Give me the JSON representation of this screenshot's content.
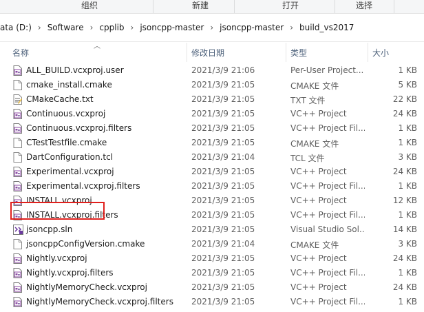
{
  "ribbon": {
    "organize": "组织",
    "new": "新建",
    "open": "打开",
    "select": "选择"
  },
  "breadcrumb": [
    "ata (D:)",
    "Software",
    "cpplib",
    "jsoncpp-master",
    "jsoncpp-master",
    "build_vs2017"
  ],
  "columns": {
    "name": "名称",
    "date": "修改日期",
    "type": "类型",
    "size": "大小"
  },
  "files": [
    {
      "name": "ALL_BUILD.vcxproj.user",
      "date": "2021/3/9 21:06",
      "type": "Per-User Project...",
      "size": "1 KB",
      "icon": "user-project-icon"
    },
    {
      "name": "cmake_install.cmake",
      "date": "2021/3/9 21:05",
      "type": "CMAKE 文件",
      "size": "5 KB",
      "icon": "file-icon"
    },
    {
      "name": "CMakeCache.txt",
      "date": "2021/3/9 21:05",
      "type": "TXT 文件",
      "size": "22 KB",
      "icon": "text-file-icon"
    },
    {
      "name": "Continuous.vcxproj",
      "date": "2021/3/9 21:05",
      "type": "VC++ Project",
      "size": "24 KB",
      "icon": "vcxproj-icon"
    },
    {
      "name": "Continuous.vcxproj.filters",
      "date": "2021/3/9 21:05",
      "type": "VC++ Project Fil...",
      "size": "1 KB",
      "icon": "vcxproj-icon"
    },
    {
      "name": "CTestTestfile.cmake",
      "date": "2021/3/9 21:05",
      "type": "CMAKE 文件",
      "size": "1 KB",
      "icon": "file-icon"
    },
    {
      "name": "DartConfiguration.tcl",
      "date": "2021/3/9 21:04",
      "type": "TCL 文件",
      "size": "3 KB",
      "icon": "file-icon"
    },
    {
      "name": "Experimental.vcxproj",
      "date": "2021/3/9 21:05",
      "type": "VC++ Project",
      "size": "24 KB",
      "icon": "vcxproj-icon"
    },
    {
      "name": "Experimental.vcxproj.filters",
      "date": "2021/3/9 21:05",
      "type": "VC++ Project Fil...",
      "size": "1 KB",
      "icon": "vcxproj-icon"
    },
    {
      "name": "INSTALL.vcxproj",
      "date": "2021/3/9 21:05",
      "type": "VC++ Project",
      "size": "12 KB",
      "icon": "vcxproj-icon"
    },
    {
      "name": "INSTALL.vcxproj.filters",
      "date": "2021/3/9 21:05",
      "type": "VC++ Project Fil...",
      "size": "1 KB",
      "icon": "vcxproj-icon"
    },
    {
      "name": "jsoncpp.sln",
      "date": "2021/3/9 21:05",
      "type": "Visual Studio Sol...",
      "size": "14 KB",
      "icon": "solution-icon"
    },
    {
      "name": "jsoncppConfigVersion.cmake",
      "date": "2021/3/9 21:04",
      "type": "CMAKE 文件",
      "size": "3 KB",
      "icon": "file-icon"
    },
    {
      "name": "Nightly.vcxproj",
      "date": "2021/3/9 21:05",
      "type": "VC++ Project",
      "size": "24 KB",
      "icon": "vcxproj-icon"
    },
    {
      "name": "Nightly.vcxproj.filters",
      "date": "2021/3/9 21:05",
      "type": "VC++ Project Fil...",
      "size": "1 KB",
      "icon": "vcxproj-icon"
    },
    {
      "name": "NightlyMemoryCheck.vcxproj",
      "date": "2021/3/9 21:05",
      "type": "VC++ Project",
      "size": "24 KB",
      "icon": "vcxproj-icon"
    },
    {
      "name": "NightlyMemoryCheck.vcxproj.filters",
      "date": "2021/3/9 21:05",
      "type": "VC++ Project Fil...",
      "size": "1 KB",
      "icon": "vcxproj-icon"
    }
  ],
  "colors": {
    "highlight": "#e0201d",
    "header_text": "#4c607a"
  }
}
